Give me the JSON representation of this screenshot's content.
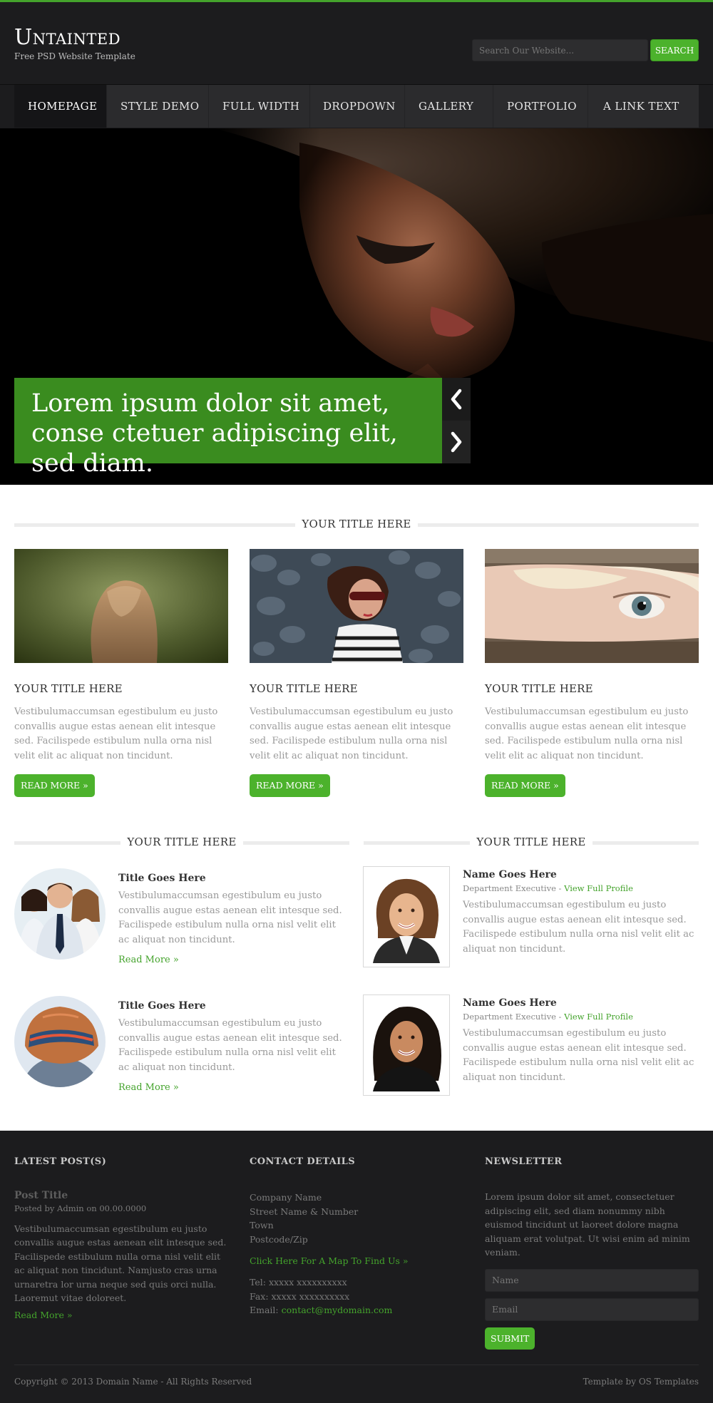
{
  "header": {
    "logo": "Untainted",
    "tagline": "Free PSD Website Template",
    "search_placeholder": "Search Our Website...",
    "search_button": "SEARCH"
  },
  "nav": {
    "items": [
      "HOMEPAGE",
      "STYLE DEMO",
      "FULL WIDTH",
      "DROPDOWN",
      "GALLERY",
      "PORTFOLIO",
      "A LINK TEXT"
    ],
    "active": "HOMEPAGE"
  },
  "hero": {
    "caption": "Lorem ipsum dolor sit amet, conse ctetuer adipiscing elit, sed diam.",
    "prev_icon": "chevron-left-icon",
    "next_icon": "chevron-right-icon"
  },
  "features": {
    "section_title": "YOUR TITLE HERE",
    "items": [
      {
        "title": "YOUR TITLE HERE",
        "text": "Vestibulumaccumsan egestibulum eu justo convallis augue estas aenean elit intesque sed. Facilispede estibulum nulla orna nisl velit elit ac aliquat non tincidunt.",
        "button": "READ MORE »"
      },
      {
        "title": "YOUR TITLE HERE",
        "text": "Vestibulumaccumsan egestibulum eu justo convallis augue estas aenean elit intesque sed. Facilispede estibulum nulla orna nisl velit elit ac aliquat non tincidunt.",
        "button": "READ MORE »"
      },
      {
        "title": "YOUR TITLE HERE",
        "text": "Vestibulumaccumsan egestibulum eu justo convallis augue estas aenean elit intesque sed. Facilispede estibulum nulla orna nisl velit elit ac aliquat non tincidunt.",
        "button": "READ MORE »"
      }
    ]
  },
  "left_block": {
    "section_title": "YOUR TITLE HERE",
    "items": [
      {
        "title": "Title Goes Here",
        "text": "Vestibulumaccumsan egestibulum eu justo convallis augue estas aenean elit intesque sed. Facilispede estibulum nulla orna nisl velit elit ac aliquat non tincidunt.",
        "link": "Read More »"
      },
      {
        "title": "Title Goes Here",
        "text": "Vestibulumaccumsan egestibulum eu justo convallis augue estas aenean elit intesque sed. Facilispede estibulum nulla orna nisl velit elit ac aliquat non tincidunt.",
        "link": "Read More »"
      }
    ]
  },
  "right_block": {
    "section_title": "YOUR TITLE HERE",
    "items": [
      {
        "name": "Name Goes Here",
        "role": "Department Executive - ",
        "link": "View Full Profile",
        "text": "Vestibulumaccumsan egestibulum eu justo convallis augue estas aenean elit intesque sed. Facilispede estibulum nulla orna nisl velit elit ac aliquat non tincidunt."
      },
      {
        "name": "Name Goes Here",
        "role": "Department Executive - ",
        "link": "View Full Profile",
        "text": "Vestibulumaccumsan egestibulum eu justo convallis augue estas aenean elit intesque sed. Facilispede estibulum nulla orna nisl velit elit ac aliquat non tincidunt."
      }
    ]
  },
  "footer": {
    "latest": {
      "heading": "LATEST POST(S)",
      "post_title": "Post Title",
      "post_meta": "Posted by Admin on 00.00.0000",
      "post_text": "Vestibulumaccumsan egestibulum eu justo convallis augue estas aenean elit intesque sed. Facilispede estibulum nulla orna nisl velit elit ac aliquat non tincidunt. Namjusto cras urna urnaretra lor urna neque sed quis orci nulla. Laoremut vitae doloreet.",
      "read_more": "Read More »"
    },
    "contact": {
      "heading": "CONTACT DETAILS",
      "company": "Company Name",
      "street": "Street Name & Number",
      "town": "Town",
      "postcode": "Postcode/Zip",
      "map_link": "Click Here For A Map To Find Us »",
      "tel": "Tel: xxxxx xxxxxxxxxx",
      "fax": "Fax: xxxxx xxxxxxxxxx",
      "email_label": "Email: ",
      "email": "contact@mydomain.com"
    },
    "newsletter": {
      "heading": "NEWSLETTER",
      "text": "Lorem ipsum dolor sit amet, consectetuer adipiscing elit, sed diam nonummy nibh euismod tincidunt ut laoreet dolore magna aliquam erat volutpat. Ut wisi enim ad minim veniam.",
      "name_placeholder": "Name",
      "email_placeholder": "Email",
      "submit": "SUBMIT"
    },
    "copyright": "Copyright © 2013 Domain Name - All Rights Reserved",
    "credit": "Template by OS Templates"
  },
  "colors": {
    "accent": "#4cb22c",
    "caption_bg": "#3a8c1f",
    "header_bg": "#1c1c1e",
    "nav_bg": "#2b2b2d",
    "footer_bg": "#1c1c1e"
  }
}
